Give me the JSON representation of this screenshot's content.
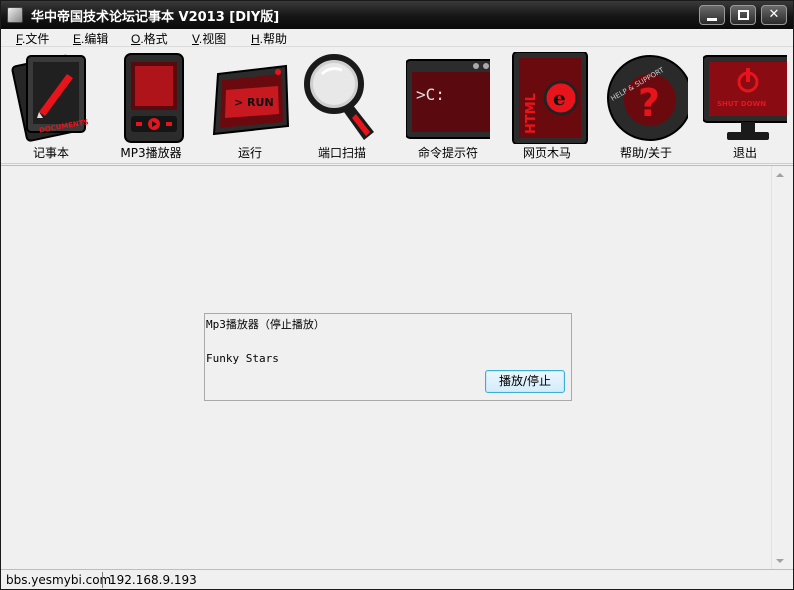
{
  "window": {
    "title": "华中帝国技术论坛记事本 V2013 [DIY版]"
  },
  "menu": [
    {
      "key": "F",
      "label": ".文件"
    },
    {
      "key": "E",
      "label": ".编辑"
    },
    {
      "key": "O",
      "label": ".格式"
    },
    {
      "key": "V",
      "label": ".视图"
    },
    {
      "key": "H",
      "label": ".帮助"
    }
  ],
  "toolbar": [
    {
      "label": "记事本",
      "icon": "notebook-icon",
      "icon_text": "DOCUMENTS"
    },
    {
      "label": "MP3播放器",
      "icon": "mp3-player-icon",
      "icon_text": ""
    },
    {
      "label": "运行",
      "icon": "run-icon",
      "icon_text": "> RUN"
    },
    {
      "label": "端口扫描",
      "icon": "magnifier-icon",
      "icon_text": ""
    },
    {
      "label": "命令提示符",
      "icon": "cmd-icon",
      "icon_text": ">C:"
    },
    {
      "label": "网页木马",
      "icon": "html-icon",
      "icon_text": "HTML"
    },
    {
      "label": "帮助/关于",
      "icon": "help-icon",
      "icon_text": "HELP & SUPPORT"
    },
    {
      "label": "退出",
      "icon": "shutdown-icon",
      "icon_text": "SHUT DOWN"
    }
  ],
  "player": {
    "title": "Mp3播放器（停止播放）",
    "track": "Funky Stars",
    "button_label": "播放/停止"
  },
  "status": {
    "site": "bbs.yesmybi.com",
    "ip": "192.168.9.193"
  },
  "colors": {
    "accent_red": "#e8141c",
    "dark": "#1a1a1a",
    "button_border": "#3cb0d4"
  }
}
